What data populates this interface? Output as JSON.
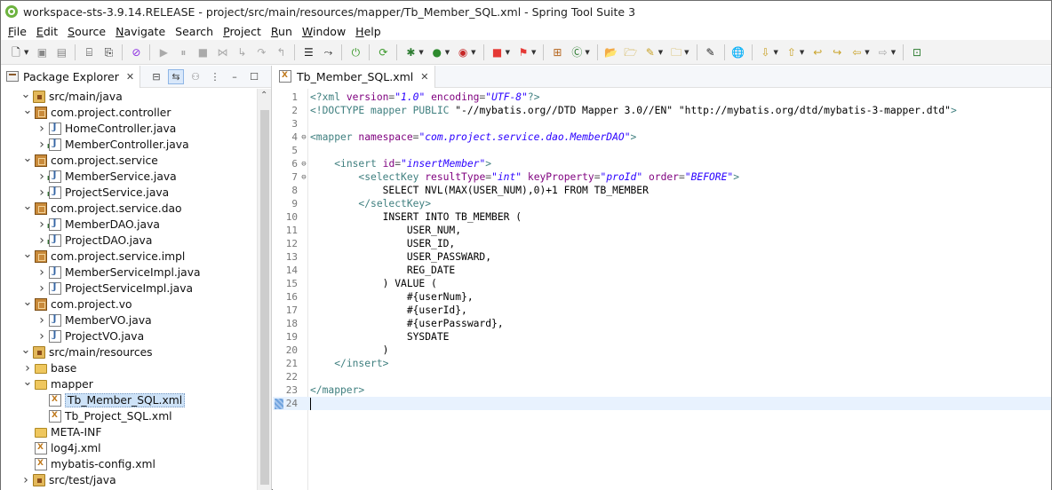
{
  "window": {
    "title": "workspace-sts-3.9.14.RELEASE - project/src/main/resources/mapper/Tb_Member_SQL.xml - Spring Tool Suite 3"
  },
  "menu": [
    {
      "mnemonic": "F",
      "rest": "ile"
    },
    {
      "mnemonic": "E",
      "rest": "dit"
    },
    {
      "mnemonic": "S",
      "rest": "ource"
    },
    {
      "mnemonic": "N",
      "rest": "avigate"
    },
    {
      "mnemonic": "",
      "rest": "Search"
    },
    {
      "mnemonic": "P",
      "rest": "roject"
    },
    {
      "mnemonic": "R",
      "rest": "un"
    },
    {
      "mnemonic": "W",
      "rest": "indow"
    },
    {
      "mnemonic": "H",
      "rest": "elp"
    }
  ],
  "explorer": {
    "title": "Package Explorer",
    "tree": [
      {
        "label": "src/main/java",
        "icon": "source-folder",
        "depth": 1,
        "twisty": "open"
      },
      {
        "label": "com.project.controller",
        "icon": "package",
        "depth": 2,
        "twisty": "open"
      },
      {
        "label": "HomeController.java",
        "icon": "java",
        "depth": 3,
        "twisty": "closed"
      },
      {
        "label": "MemberController.java",
        "icon": "java-interface",
        "depth": 3,
        "twisty": "closed"
      },
      {
        "label": "com.project.service",
        "icon": "package",
        "depth": 2,
        "twisty": "open"
      },
      {
        "label": "MemberService.java",
        "icon": "java-interface",
        "depth": 3,
        "twisty": "closed"
      },
      {
        "label": "ProjectService.java",
        "icon": "java-interface",
        "depth": 3,
        "twisty": "closed"
      },
      {
        "label": "com.project.service.dao",
        "icon": "package",
        "depth": 2,
        "twisty": "open"
      },
      {
        "label": "MemberDAO.java",
        "icon": "java-interface",
        "depth": 3,
        "twisty": "closed"
      },
      {
        "label": "ProjectDAO.java",
        "icon": "java-interface",
        "depth": 3,
        "twisty": "closed"
      },
      {
        "label": "com.project.service.impl",
        "icon": "package",
        "depth": 2,
        "twisty": "open"
      },
      {
        "label": "MemberServiceImpl.java",
        "icon": "java",
        "depth": 3,
        "twisty": "closed"
      },
      {
        "label": "ProjectServiceImpl.java",
        "icon": "java",
        "depth": 3,
        "twisty": "closed"
      },
      {
        "label": "com.project.vo",
        "icon": "package",
        "depth": 2,
        "twisty": "open"
      },
      {
        "label": "MemberVO.java",
        "icon": "java",
        "depth": 3,
        "twisty": "closed"
      },
      {
        "label": "ProjectVO.java",
        "icon": "java",
        "depth": 3,
        "twisty": "closed"
      },
      {
        "label": "src/main/resources",
        "icon": "source-folder",
        "depth": 1,
        "twisty": "open"
      },
      {
        "label": "base",
        "icon": "folder",
        "depth": 2,
        "twisty": "closed"
      },
      {
        "label": "mapper",
        "icon": "folder",
        "depth": 2,
        "twisty": "open"
      },
      {
        "label": "Tb_Member_SQL.xml",
        "icon": "xml",
        "depth": 3,
        "twisty": "none",
        "selected": true
      },
      {
        "label": "Tb_Project_SQL.xml",
        "icon": "xml",
        "depth": 3,
        "twisty": "none"
      },
      {
        "label": "META-INF",
        "icon": "folder",
        "depth": 2,
        "twisty": "none"
      },
      {
        "label": "log4j.xml",
        "icon": "xml",
        "depth": 2,
        "twisty": "none"
      },
      {
        "label": "mybatis-config.xml",
        "icon": "xml",
        "depth": 2,
        "twisty": "none"
      },
      {
        "label": "src/test/java",
        "icon": "source-folder",
        "depth": 1,
        "twisty": "closed"
      }
    ]
  },
  "editor": {
    "tab_title": "Tb_Member_SQL.xml",
    "current_line": 24,
    "lines": [
      {
        "n": "1",
        "fold": "",
        "segs": [
          [
            "t-tag",
            "<?xml "
          ],
          [
            "t-attr",
            "version"
          ],
          [
            "t-gray",
            "="
          ],
          [
            "t-str",
            "\"1.0\""
          ],
          [
            "t-gray",
            " "
          ],
          [
            "t-attr",
            "encoding"
          ],
          [
            "t-gray",
            "="
          ],
          [
            "t-str",
            "\"UTF-8\""
          ],
          [
            "t-tag",
            "?>"
          ]
        ]
      },
      {
        "n": "2",
        "fold": "",
        "segs": [
          [
            "t-tag",
            "<!DOCTYPE mapper PUBLIC "
          ],
          [
            "t-sql",
            "\"-//mybatis.org//DTD Mapper 3.0//EN\" \"http://mybatis.org/dtd/mybatis-3-mapper.dtd\""
          ],
          [
            "t-tag",
            ">"
          ]
        ]
      },
      {
        "n": "3",
        "fold": "",
        "segs": []
      },
      {
        "n": "4",
        "fold": "⊖",
        "segs": [
          [
            "t-tag",
            "<mapper "
          ],
          [
            "t-attr",
            "namespace"
          ],
          [
            "t-gray",
            "="
          ],
          [
            "t-str",
            "\"com.project.service.dao.MemberDAO\""
          ],
          [
            "t-tag",
            ">"
          ]
        ]
      },
      {
        "n": "5",
        "fold": "",
        "segs": []
      },
      {
        "n": "6",
        "fold": "⊖",
        "segs": [
          [
            "t-sql",
            "    "
          ],
          [
            "t-tag",
            "<insert "
          ],
          [
            "t-attr",
            "id"
          ],
          [
            "t-gray",
            "="
          ],
          [
            "t-str",
            "\"insertMember\""
          ],
          [
            "t-tag",
            ">"
          ]
        ]
      },
      {
        "n": "7",
        "fold": "⊖",
        "segs": [
          [
            "t-sql",
            "        "
          ],
          [
            "t-tag",
            "<selectKey "
          ],
          [
            "t-attr",
            "resultType"
          ],
          [
            "t-gray",
            "="
          ],
          [
            "t-str",
            "\"int\""
          ],
          [
            "t-gray",
            " "
          ],
          [
            "t-attr",
            "keyProperty"
          ],
          [
            "t-gray",
            "="
          ],
          [
            "t-str",
            "\"proId\""
          ],
          [
            "t-gray",
            " "
          ],
          [
            "t-attr",
            "order"
          ],
          [
            "t-gray",
            "="
          ],
          [
            "t-str",
            "\"BEFORE\""
          ],
          [
            "t-tag",
            ">"
          ]
        ]
      },
      {
        "n": "8",
        "fold": "",
        "segs": [
          [
            "t-sql",
            "            SELECT NVL(MAX(USER_NUM),0)+1 FROM TB_MEMBER"
          ]
        ]
      },
      {
        "n": "9",
        "fold": "",
        "segs": [
          [
            "t-sql",
            "        "
          ],
          [
            "t-tag",
            "</selectKey>"
          ]
        ]
      },
      {
        "n": "10",
        "fold": "",
        "segs": [
          [
            "t-sql",
            "            INSERT INTO TB_MEMBER ("
          ]
        ]
      },
      {
        "n": "11",
        "fold": "",
        "segs": [
          [
            "t-sql",
            "                USER_NUM,"
          ]
        ]
      },
      {
        "n": "12",
        "fold": "",
        "segs": [
          [
            "t-sql",
            "                USER_ID,"
          ]
        ]
      },
      {
        "n": "13",
        "fold": "",
        "segs": [
          [
            "t-sql",
            "                USER_PASSWARD,"
          ]
        ]
      },
      {
        "n": "14",
        "fold": "",
        "segs": [
          [
            "t-sql",
            "                REG_DATE"
          ]
        ]
      },
      {
        "n": "15",
        "fold": "",
        "segs": [
          [
            "t-sql",
            "            ) VALUE ("
          ]
        ]
      },
      {
        "n": "16",
        "fold": "",
        "segs": [
          [
            "t-sql",
            "                #{userNum},"
          ]
        ]
      },
      {
        "n": "17",
        "fold": "",
        "segs": [
          [
            "t-sql",
            "                #{userId},"
          ]
        ]
      },
      {
        "n": "18",
        "fold": "",
        "segs": [
          [
            "t-sql",
            "                #{userPassward},"
          ]
        ]
      },
      {
        "n": "19",
        "fold": "",
        "segs": [
          [
            "t-sql",
            "                SYSDATE"
          ]
        ]
      },
      {
        "n": "20",
        "fold": "",
        "segs": [
          [
            "t-sql",
            "            )"
          ]
        ]
      },
      {
        "n": "21",
        "fold": "",
        "segs": [
          [
            "t-sql",
            "    "
          ],
          [
            "t-tag",
            "</insert>"
          ]
        ]
      },
      {
        "n": "22",
        "fold": "",
        "segs": []
      },
      {
        "n": "23",
        "fold": "",
        "segs": [
          [
            "t-tag",
            "</mapper>"
          ]
        ]
      },
      {
        "n": "24",
        "fold": "",
        "segs": []
      }
    ]
  }
}
